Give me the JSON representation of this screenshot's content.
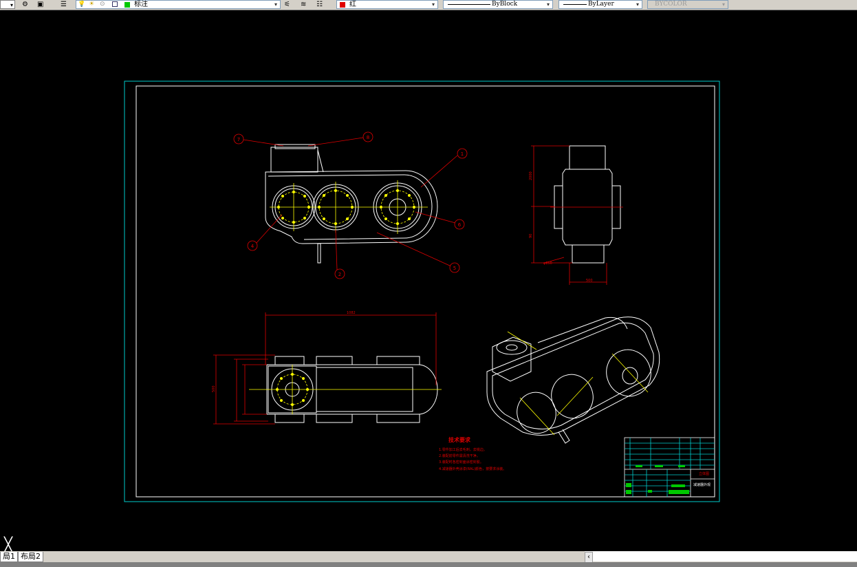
{
  "toolbar": {
    "layer_name": "标注",
    "color_name": "红",
    "linetype": "ByBlock",
    "lineweight": "ByLayer",
    "plotstyle": "BYCOLOR",
    "layer_color": "#00c800",
    "color_swatch": "#e00000"
  },
  "layout_tabs": [
    "局1",
    "布局2"
  ],
  "drawing": {
    "title_block_name": "立体图",
    "title_block_subname": "减速器外观",
    "tech_title": "技术要求",
    "tech_notes": [
      "1.零件加工后去毛刺，去锐边。",
      "2.装配前零件需清洗干净。",
      "3.装配时各密封面涂密封胶。",
      "4.减速器外壳涂漆(RAL)颜色，按要求涂装。"
    ],
    "balloons": [
      "7",
      "8",
      "1",
      "4",
      "6",
      "2",
      "5"
    ],
    "dims": {
      "top_overall": "1082",
      "side_height": "2000",
      "side_width": "500",
      "side_bottom": "90",
      "bottom_left": "500",
      "side_label": "φ150"
    }
  },
  "colors": {
    "model_bg": "#000000",
    "geometry": "#ffffff",
    "dimension": "#e00000",
    "centerline": "#ffff00",
    "border": "#00cccc",
    "title_table": "#00c800"
  },
  "ucs_icon": "ucs-icon",
  "scroll_icon": "chevron-left-icon"
}
